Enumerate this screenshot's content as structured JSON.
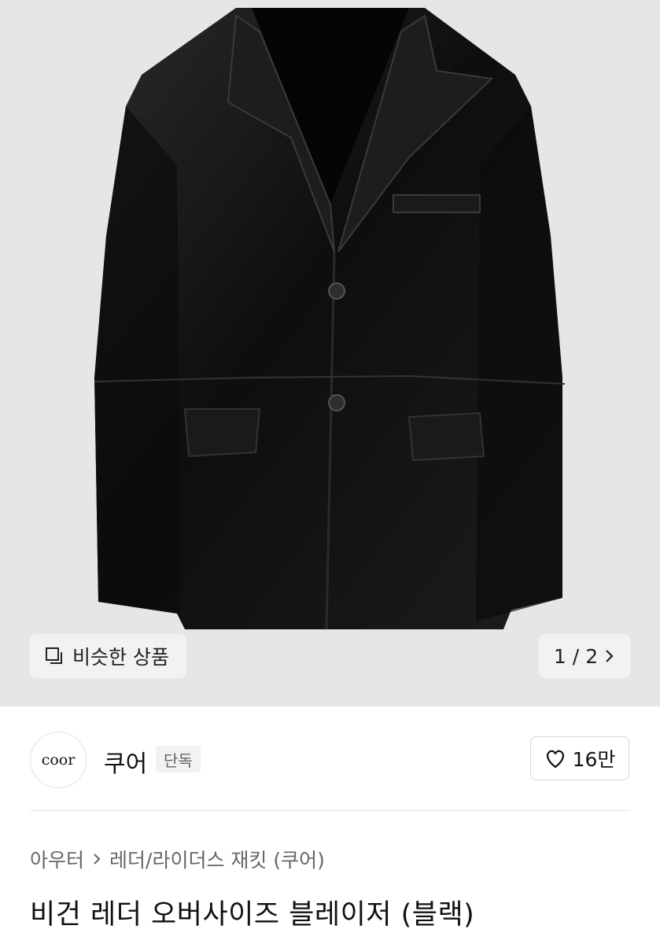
{
  "gallery": {
    "similar_label": "비슷한 상품",
    "current": "1",
    "sep": "/",
    "total": "2"
  },
  "brand": {
    "logo_text": "coor",
    "name": "쿠어",
    "tag": "단독"
  },
  "like": {
    "count": "16만"
  },
  "breadcrumb": {
    "items": [
      "아우터",
      "레더/라이더스 재킷 (쿠어)"
    ]
  },
  "product": {
    "title": "비건 레더 오버사이즈 블레이저 (블랙)"
  },
  "colors": {
    "hero_bg": "#e6e6e6",
    "jacket": "#141414",
    "chip_bg": "#f2f2f2"
  }
}
